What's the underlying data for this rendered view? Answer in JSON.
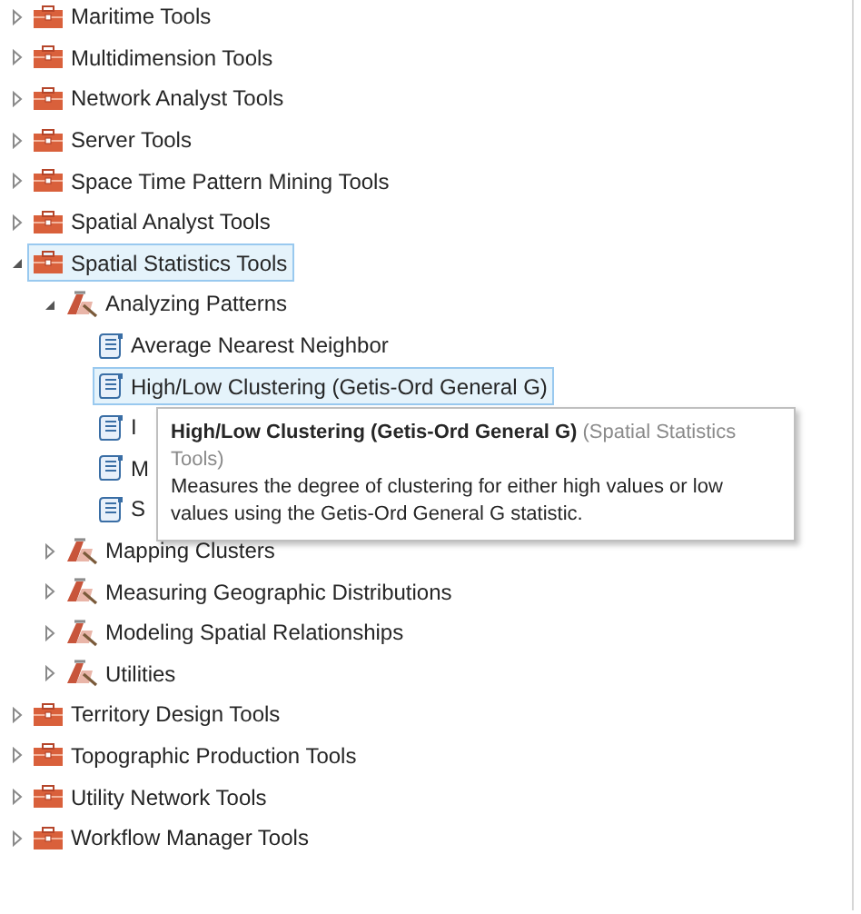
{
  "tree": [
    {
      "label": "Maritime Tools",
      "kind": "toolbox",
      "expanded": false,
      "selected": false
    },
    {
      "label": "Multidimension Tools",
      "kind": "toolbox",
      "expanded": false,
      "selected": false
    },
    {
      "label": "Network Analyst Tools",
      "kind": "toolbox",
      "expanded": false,
      "selected": false
    },
    {
      "label": "Server Tools",
      "kind": "toolbox",
      "expanded": false,
      "selected": false
    },
    {
      "label": "Space Time Pattern Mining Tools",
      "kind": "toolbox",
      "expanded": false,
      "selected": false
    },
    {
      "label": "Spatial Analyst Tools",
      "kind": "toolbox",
      "expanded": false,
      "selected": false
    },
    {
      "label": "Spatial Statistics Tools",
      "kind": "toolbox",
      "expanded": true,
      "selected": true,
      "children": [
        {
          "label": "Analyzing Patterns",
          "kind": "toolset",
          "expanded": true,
          "selected": false,
          "children": [
            {
              "label": "Average Nearest Neighbor",
              "kind": "tool",
              "selected": false
            },
            {
              "label": "High/Low Clustering (Getis-Ord General G)",
              "kind": "tool",
              "selected": true
            },
            {
              "label": "I",
              "kind": "tool",
              "selected": false
            },
            {
              "label": "M",
              "kind": "tool",
              "selected": false
            },
            {
              "label": "S",
              "kind": "tool",
              "selected": false
            }
          ]
        },
        {
          "label": "Mapping Clusters",
          "kind": "toolset",
          "expanded": false,
          "selected": false
        },
        {
          "label": "Measuring Geographic Distributions",
          "kind": "toolset",
          "expanded": false,
          "selected": false
        },
        {
          "label": "Modeling Spatial Relationships",
          "kind": "toolset",
          "expanded": false,
          "selected": false
        },
        {
          "label": "Utilities",
          "kind": "toolset",
          "expanded": false,
          "selected": false
        }
      ]
    },
    {
      "label": "Territory Design Tools",
      "kind": "toolbox",
      "expanded": false,
      "selected": false
    },
    {
      "label": "Topographic Production Tools",
      "kind": "toolbox",
      "expanded": false,
      "selected": false
    },
    {
      "label": "Utility Network Tools",
      "kind": "toolbox",
      "expanded": false,
      "selected": false
    },
    {
      "label": "Workflow Manager Tools",
      "kind": "toolbox",
      "expanded": false,
      "selected": false
    }
  ],
  "tooltip": {
    "title": "High/Low Clustering (Getis-Ord General G)",
    "source": "(Spatial Statistics Tools)",
    "description": "Measures the degree of clustering for either high values or low values using the Getis-Ord General G statistic."
  }
}
